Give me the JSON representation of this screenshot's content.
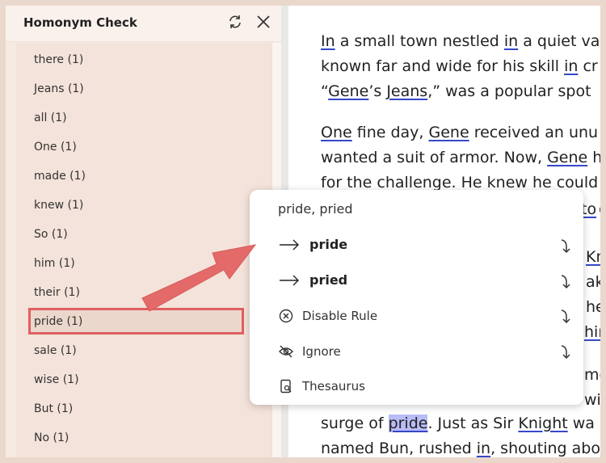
{
  "sidebar": {
    "title": "Homonym Check",
    "refresh_icon": "refresh-icon",
    "close_icon": "close-icon",
    "items": [
      {
        "label": "there (1)"
      },
      {
        "label": "Jeans (1)"
      },
      {
        "label": "all (1)"
      },
      {
        "label": "One (1)"
      },
      {
        "label": "made (1)"
      },
      {
        "label": "knew (1)"
      },
      {
        "label": "So (1)"
      },
      {
        "label": "him (1)"
      },
      {
        "label": "their (1)"
      },
      {
        "label": "pride (1)"
      },
      {
        "label": "sale (1)"
      },
      {
        "label": "wise (1)"
      },
      {
        "label": "But (1)"
      },
      {
        "label": "No (1)"
      }
    ],
    "selected_item": "pride (1)"
  },
  "document": {
    "p1": {
      "l1": {
        "a": "In",
        "b": " a small town nestled ",
        "c": "in",
        "d": " a quiet va"
      },
      "l2": {
        "a": "known far and wide for his skill ",
        "b": "in",
        "c": " cr"
      },
      "l3": {
        "a": "“",
        "b": "Gene",
        "c": "’s ",
        "d": "Jeans",
        "e": ",” was a popular spot"
      }
    },
    "p2": {
      "l1": {
        "a": "One",
        "b": " fine day, ",
        "c": "Gene",
        "d": " received an unu"
      },
      "l2": {
        "a": "wanted a suit of armor. Now, ",
        "b": "Gene",
        "c": " h"
      },
      "l3": "for the challenge. He knew he could"
    },
    "right_fragments": {
      "f1": "to",
      "f2": "g",
      "f3": "Kn",
      "f4": "ake",
      "f5": "he",
      "f6": "hin",
      "f7": "mo",
      "f8": "wi"
    },
    "p3": {
      "l1": {
        "a": "surge of ",
        "b": "pride",
        "c": ". Just as Sir ",
        "d": "Knight",
        "e": " wa"
      },
      "l2": {
        "a": "named Bun, rushed ",
        "b": "in",
        "c": ", shouting abo"
      }
    }
  },
  "popup": {
    "title": "pride, pried",
    "suggestions": [
      {
        "label": "pride",
        "icon": "arrow-right-icon",
        "action_icon": "apply-icon"
      },
      {
        "label": "pried",
        "icon": "arrow-right-icon",
        "action_icon": "apply-icon"
      }
    ],
    "actions": [
      {
        "label": "Disable Rule",
        "icon": "disable-icon",
        "action_icon": "apply-icon"
      },
      {
        "label": "Ignore",
        "icon": "eye-off-icon",
        "action_icon": "apply-icon"
      },
      {
        "label": "Thesaurus",
        "icon": "thesaurus-icon"
      }
    ]
  },
  "colors": {
    "accent": "#e06060",
    "underline": "#3548c8",
    "highlight": "#b9bcf6",
    "sidebar_bg": "#f4e3da"
  }
}
